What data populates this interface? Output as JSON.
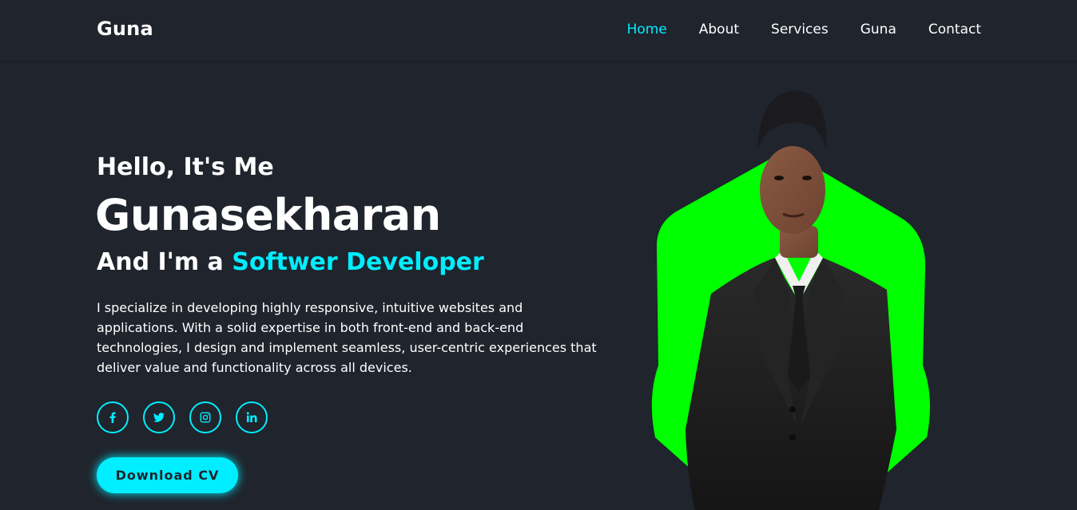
{
  "header": {
    "logo": "Guna",
    "nav": [
      {
        "label": "Home",
        "active": true
      },
      {
        "label": "About",
        "active": false
      },
      {
        "label": "Services",
        "active": false
      },
      {
        "label": "Guna",
        "active": false
      },
      {
        "label": "Contact",
        "active": false
      }
    ]
  },
  "hero": {
    "greeting": "Hello, It's Me",
    "name": "Gunasekharan",
    "role_prefix": "And I'm a ",
    "role_highlight": "Softwer Developer",
    "description": "I specialize in developing highly responsive, intuitive websites and applications. With a solid expertise in both front-end and back-end technologies, I design and implement seamless, user-centric experiences that deliver value and functionality across all devices.",
    "socials": [
      {
        "icon": "facebook-icon"
      },
      {
        "icon": "twitter-icon"
      },
      {
        "icon": "instagram-icon"
      },
      {
        "icon": "linkedin-icon"
      }
    ],
    "button_label": "Download CV"
  },
  "colors": {
    "background": "#1f242d",
    "accent": "#00eeff",
    "hexagon": "#00ff00",
    "text": "#ffffff"
  }
}
